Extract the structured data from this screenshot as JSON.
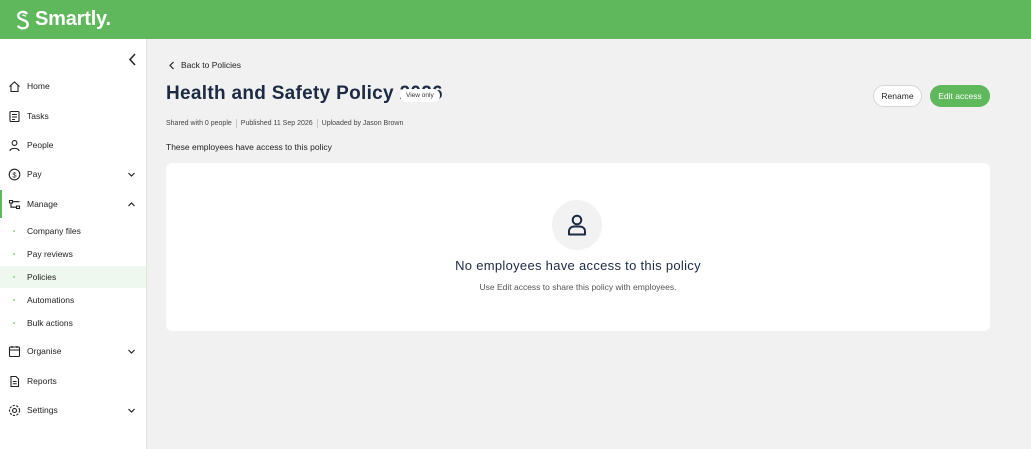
{
  "brand": {
    "name": "Smartly.",
    "color": "#5fb85c"
  },
  "sidebar": {
    "items": [
      {
        "label": "Home",
        "icon": "home-icon"
      },
      {
        "label": "Tasks",
        "icon": "tasks-icon"
      },
      {
        "label": "People",
        "icon": "people-icon"
      },
      {
        "label": "Pay",
        "icon": "pay-icon"
      },
      {
        "label": "Manage",
        "icon": "manage-icon"
      },
      {
        "label": "Organise",
        "icon": "organise-icon"
      },
      {
        "label": "Reports",
        "icon": "reports-icon"
      },
      {
        "label": "Settings",
        "icon": "settings-icon"
      }
    ],
    "manage_sub": [
      {
        "label": "Company files"
      },
      {
        "label": "Pay reviews"
      },
      {
        "label": "Policies",
        "active": true
      },
      {
        "label": "Automations"
      },
      {
        "label": "Bulk actions"
      }
    ]
  },
  "main": {
    "back_label": "Back to Policies",
    "title": "Health and Safety Policy 2026",
    "badge": "View only",
    "rename_label": "Rename",
    "edit_access_label": "Edit access",
    "meta": {
      "shared": "Shared with 0 people",
      "published": "Published 11 Sep 2026",
      "uploaded": "Uploaded by Jason Brown"
    },
    "section_label": "These employees have access to this policy",
    "empty": {
      "icon": "person-icon",
      "title": "No employees have access to this policy",
      "subtitle": "Use Edit access to share this policy with employees."
    }
  }
}
